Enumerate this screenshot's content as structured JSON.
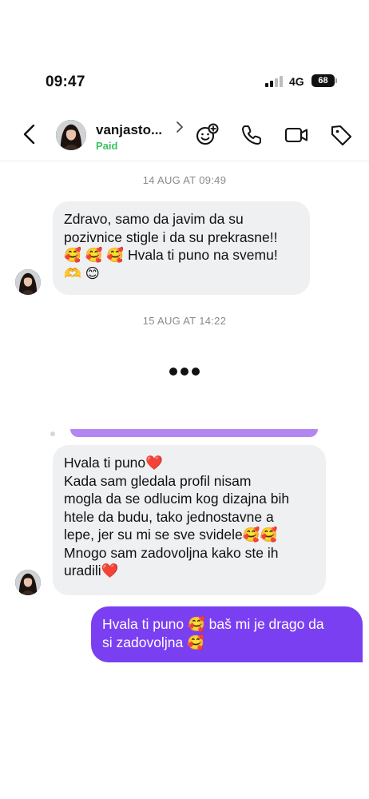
{
  "status_bar": {
    "time": "09:47",
    "network": "4G",
    "battery": "68"
  },
  "header": {
    "contact_name": "vanjasto...",
    "contact_status": "Paid"
  },
  "chat": {
    "date_1": "14 AUG AT 09:49",
    "date_2": "15 AUG AT 14:22",
    "message_1": "Zdravo, samo da javim da su\npozivnice stigle i da su prekrasne!!\n🥰 🥰 🥰  Hvala ti puno na svemu!\n🫶 😊",
    "message_2": "Hvala ti puno❤️\nKada sam gledala profil nisam\nmogla da se odlucim kog dizajna bih\nhtele da budu, tako jednostavne a\nlepe, jer su mi se sve svidele🥰🥰\nMnogo sam zadovoljna kako ste ih\nuradili❤️",
    "reply_1": "Hvala ti puno 🥰 baš mi je drago da\nsi zadovoljna 🥰"
  },
  "colors": {
    "accent": "#7b3ff2",
    "paid": "#39c360",
    "bubble_incoming": "#eff0f2"
  },
  "icons": [
    "back-chevron-icon",
    "add-emoji-icon",
    "phone-icon",
    "video-camera-icon",
    "tag-icon",
    "typing-indicator-icon"
  ]
}
